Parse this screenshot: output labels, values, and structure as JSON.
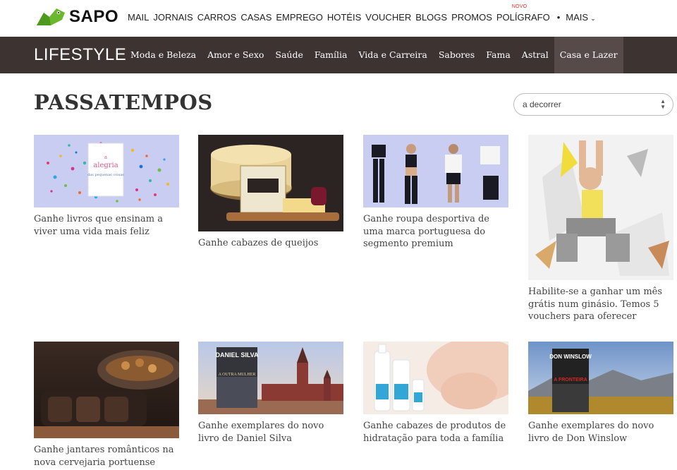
{
  "topbar": {
    "brand": "SAPO",
    "nav": [
      "MAIL",
      "JORNAIS",
      "CARROS",
      "CASAS",
      "EMPREGO",
      "HOTÉIS",
      "VOUCHER",
      "BLOGS",
      "PROMOS"
    ],
    "poligrafo": "POLÍGRAFO",
    "novo_badge": "NOVO",
    "dot": "•",
    "mais": "MAIS"
  },
  "section": {
    "brand": "LIFESTYLE",
    "nav": [
      {
        "label": "Moda e Beleza",
        "active": false
      },
      {
        "label": "Amor e Sexo",
        "active": false
      },
      {
        "label": "Saúde",
        "active": false
      },
      {
        "label": "Família",
        "active": false
      },
      {
        "label": "Vida e Carreira",
        "active": false
      },
      {
        "label": "Sabores",
        "active": false
      },
      {
        "label": "Fama",
        "active": false
      },
      {
        "label": "Astral",
        "active": false
      },
      {
        "label": "Casa e Lazer",
        "active": true
      }
    ]
  },
  "page": {
    "title": "PASSATEMPOS",
    "filter_value": "a decorrer"
  },
  "cards": [
    {
      "caption": "Ganhe livros que ensinam a viver uma vida mais feliz"
    },
    {
      "caption": "Ganhe cabazes de queijos"
    },
    {
      "caption": "Ganhe roupa desportiva de uma marca portuguesa do segmento premium"
    },
    {
      "caption": "Habilite-se a ganhar um mês grátis num ginásio. Temos 5 vouchers para oferecer"
    },
    {
      "caption": "Ganhe jantares românticos na nova cervejaria portuense"
    },
    {
      "caption": "Ganhe exemplares do novo livro de Daniel Silva"
    },
    {
      "caption": "Ganhe cabazes de produtos de hidratação para toda a família"
    },
    {
      "caption": "Ganhe exemplares do novo livro de Don Winslow"
    }
  ],
  "image_text": {
    "book1_a": "a",
    "book1_b": "alegria",
    "book1_c": "das pequenas coisas",
    "daniel_author": "DANIEL SILVA",
    "daniel_sub": "A OUTRA MULHER",
    "winslow_author": "DON WINSLOW",
    "winslow_title": "A FRONTEIRA"
  }
}
